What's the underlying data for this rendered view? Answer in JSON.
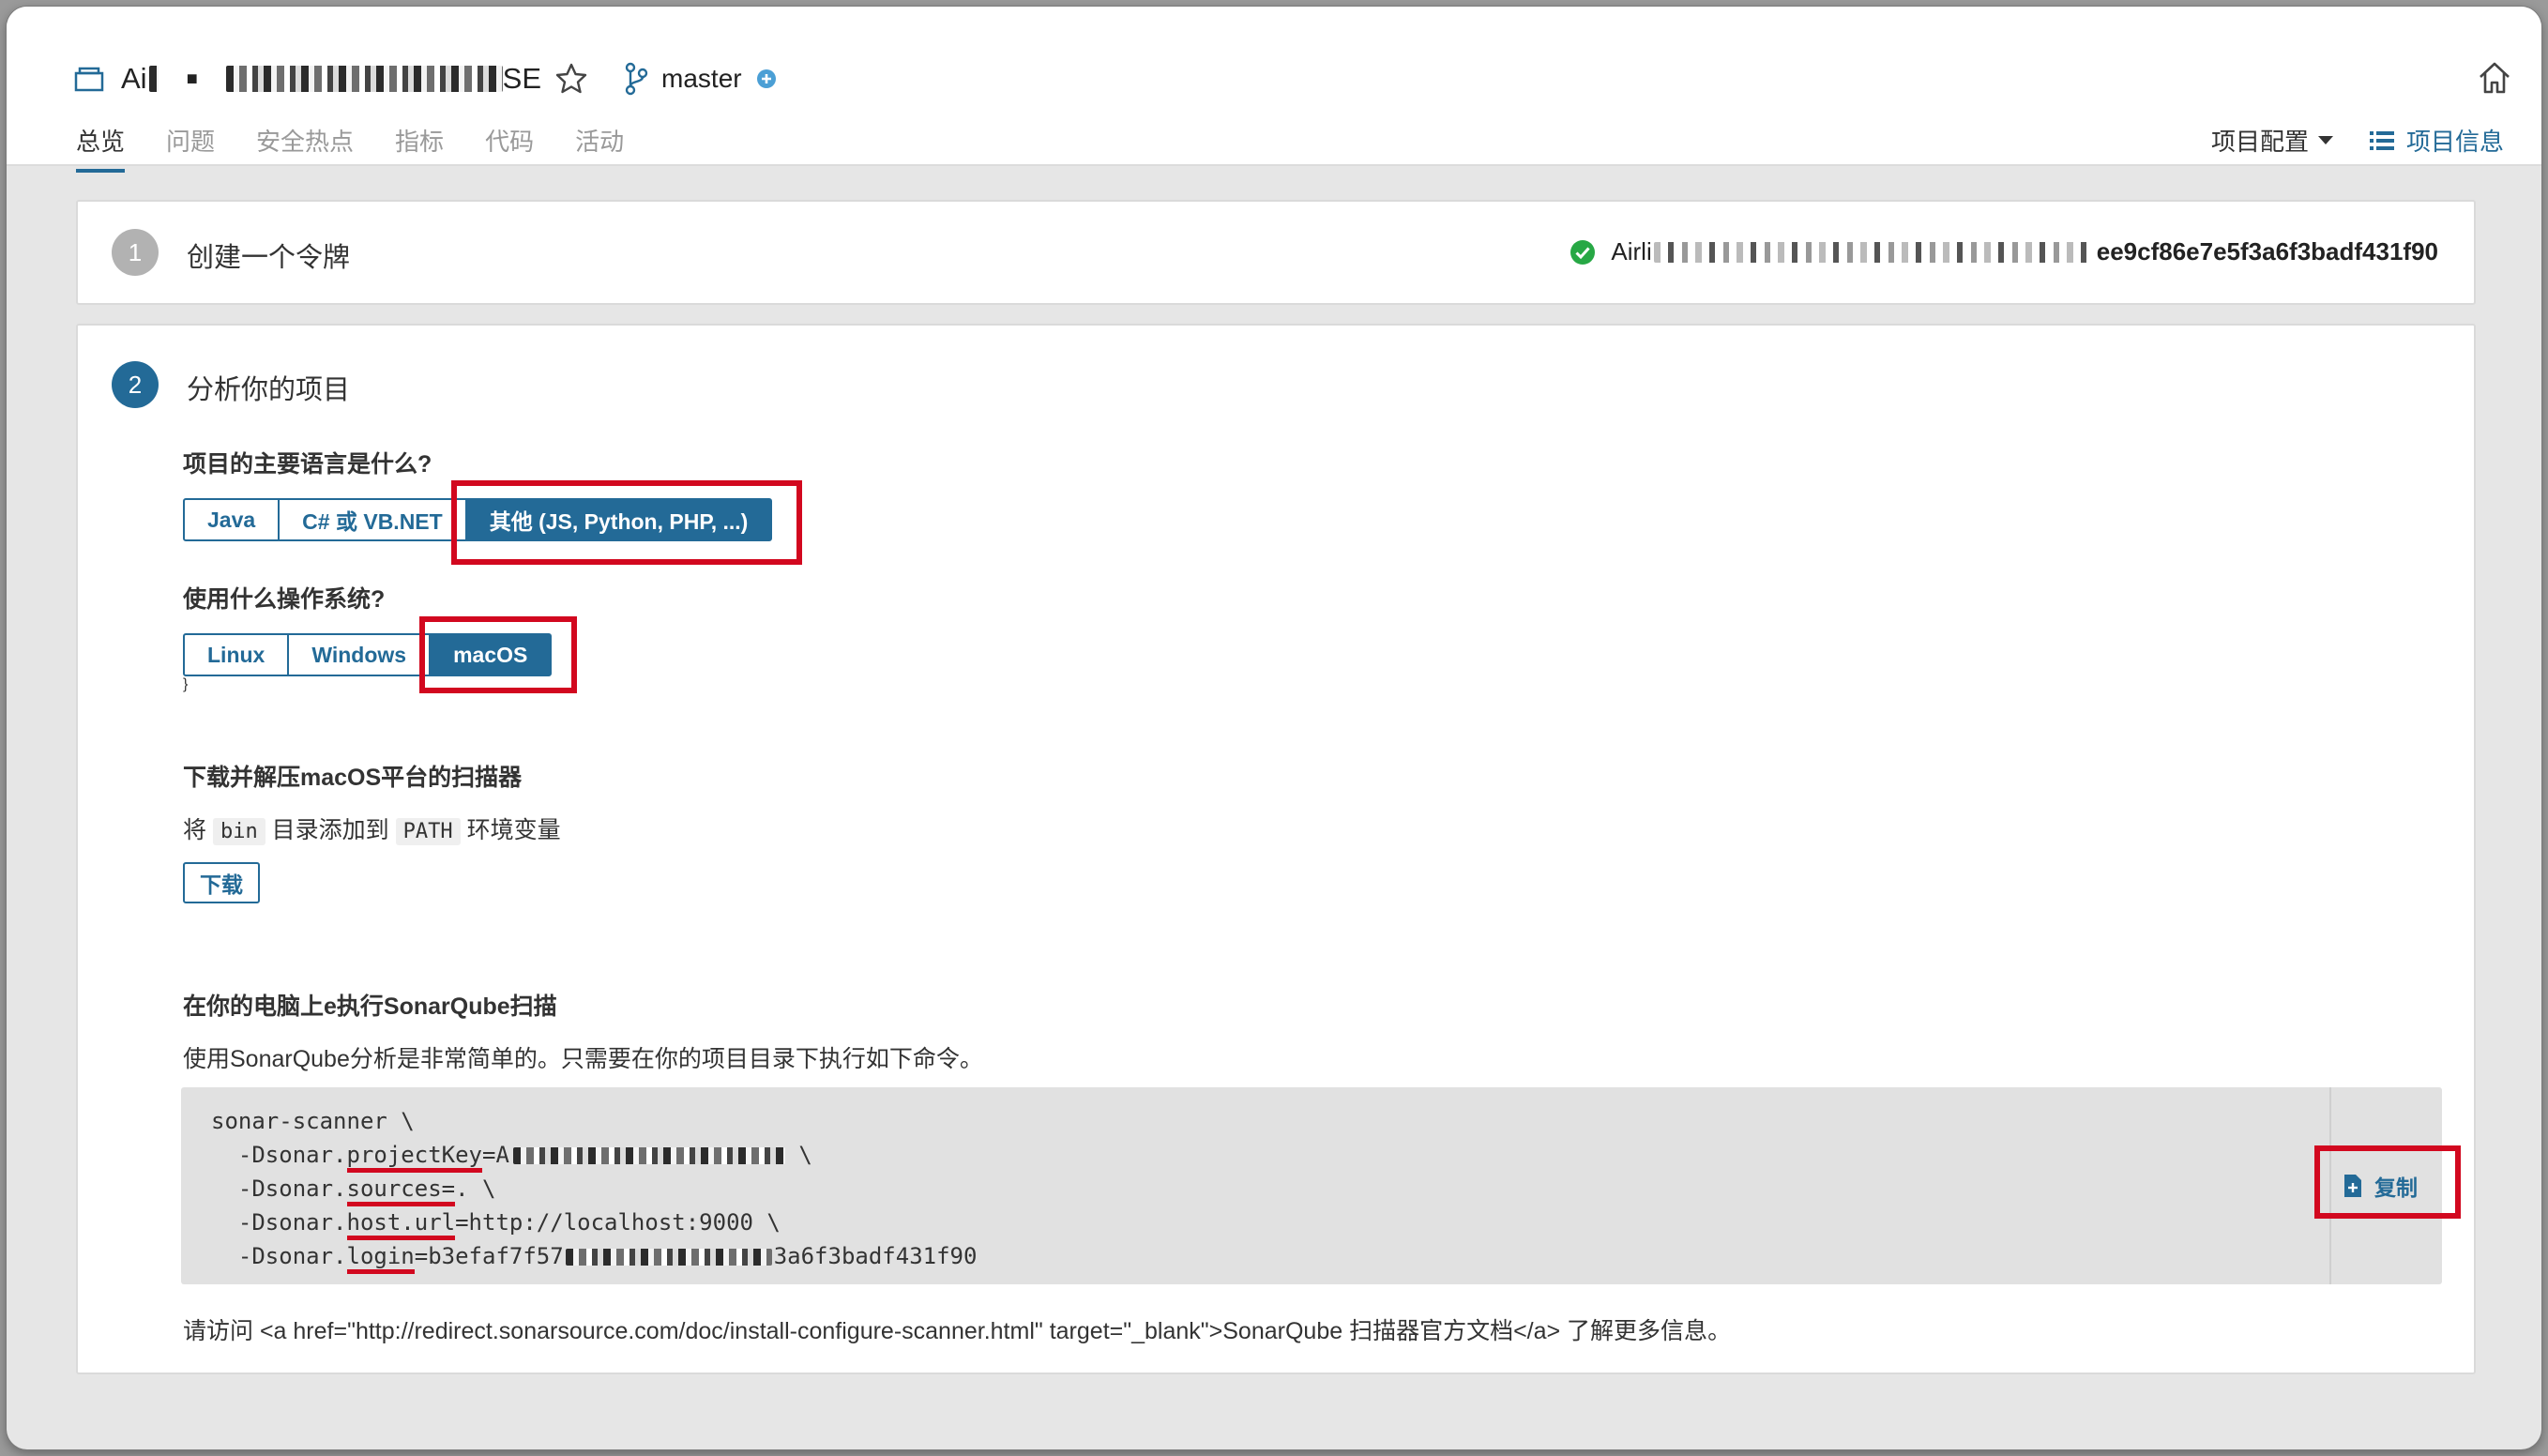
{
  "header": {
    "project_name_prefix": "Ai",
    "project_name_bullet": "■",
    "project_name_suffix": "SE",
    "branch": "master"
  },
  "nav": {
    "tabs": [
      {
        "label": "总览",
        "active": true
      },
      {
        "label": "问题"
      },
      {
        "label": "安全热点"
      },
      {
        "label": "指标"
      },
      {
        "label": "代码"
      },
      {
        "label": "活动"
      }
    ],
    "project_config": "项目配置",
    "project_info": "项目信息"
  },
  "step1": {
    "number": "1",
    "title": "创建一个令牌",
    "token_prefix": "Airli",
    "token_suffix": "ee9cf86e7e5f3a6f3badf431f90"
  },
  "step2": {
    "number": "2",
    "title": "分析你的项目",
    "language_question": "项目的主要语言是什么?",
    "languages": [
      "Java",
      "C# 或 VB.NET",
      "其他 (JS, Python, PHP, ...)"
    ],
    "selected_language": "其他 (JS, Python, PHP, ...)",
    "os_question": "使用什么操作系统?",
    "os_options": [
      "Linux",
      "Windows",
      "macOS"
    ],
    "selected_os": "macOS",
    "download_heading": "下载并解压macOS平台的扫描器",
    "path_text_1": "将",
    "path_code_bin": "bin",
    "path_text_2": "目录添加到",
    "path_code_path": "PATH",
    "path_text_3": "环境变量",
    "download_button": "下载",
    "execute_heading": "在你的电脑上e执行SonarQube扫描",
    "execute_desc": "使用SonarQube分析是非常简单的。只需要在你的项目目录下执行如下命令。",
    "code": {
      "line1": "sonar-scanner \\",
      "line2_pre": "  -Dsonar.",
      "line2_key": "projectKey",
      "line2_val": "=A",
      "line2_end": " \\",
      "line3_pre": "  -Dsonar.",
      "line3_key": "sources=",
      "line3_end": ". \\",
      "line4_pre": "  -Dsonar.",
      "line4_key": "host.url",
      "line4_end": "=http://localhost:9000 \\",
      "line5_pre": "  -Dsonar.",
      "line5_key": "login",
      "line5_val": "=b3efaf7f57",
      "line5_end": "3a6f3badf431f90"
    },
    "copy_button": "复制",
    "footnote": "请访问 <a href=\"http://redirect.sonarsource.com/doc/install-configure-scanner.html\" target=\"_blank\">SonarQube 扫描器官方文档</a> 了解更多信息。"
  },
  "colors": {
    "accent": "#236a97",
    "highlight": "#d2081f",
    "success": "#27a845"
  }
}
